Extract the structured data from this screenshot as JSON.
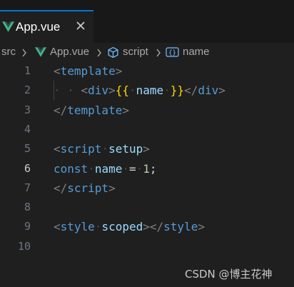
{
  "tab": {
    "title": "App.vue"
  },
  "breadcrumb": {
    "src": "src",
    "file": "App.vue",
    "section": "script",
    "symbol": "name"
  },
  "editor": {
    "active_line": "6",
    "lines": [
      {
        "number": "1",
        "tokens": [
          [
            "tg",
            "<"
          ],
          [
            "tn",
            "template"
          ],
          [
            "tg",
            ">"
          ]
        ]
      },
      {
        "number": "2",
        "tokens": [
          [
            "ws",
            "· · "
          ],
          [
            "tg",
            "<"
          ],
          [
            "tn",
            "div"
          ],
          [
            "tg",
            ">"
          ],
          [
            "br",
            "{{"
          ],
          [
            "ws",
            "·"
          ],
          [
            "vr",
            "name"
          ],
          [
            "ws",
            "·"
          ],
          [
            "br",
            "}}"
          ],
          [
            "tg",
            "</"
          ],
          [
            "tn",
            "div"
          ],
          [
            "tg",
            ">"
          ]
        ]
      },
      {
        "number": "3",
        "tokens": [
          [
            "tg",
            "</"
          ],
          [
            "tn",
            "template"
          ],
          [
            "tg",
            ">"
          ]
        ]
      },
      {
        "number": "4",
        "tokens": []
      },
      {
        "number": "5",
        "tokens": [
          [
            "tg",
            "<"
          ],
          [
            "tn",
            "script"
          ],
          [
            "ws",
            "·"
          ],
          [
            "at",
            "setup"
          ],
          [
            "tg",
            ">"
          ]
        ]
      },
      {
        "number": "6",
        "tokens": [
          [
            "kw",
            "const"
          ],
          [
            "ws",
            "·"
          ],
          [
            "vr",
            "name"
          ],
          [
            "ws",
            "·"
          ],
          [
            "op",
            "="
          ],
          [
            "ws",
            "·"
          ],
          [
            "nm",
            "1"
          ],
          [
            "op",
            ";"
          ]
        ]
      },
      {
        "number": "7",
        "tokens": [
          [
            "tg",
            "</"
          ],
          [
            "tn",
            "script"
          ],
          [
            "tg",
            ">"
          ]
        ]
      },
      {
        "number": "8",
        "tokens": []
      },
      {
        "number": "9",
        "tokens": [
          [
            "tg",
            "<"
          ],
          [
            "tn",
            "style"
          ],
          [
            "ws",
            "·"
          ],
          [
            "at",
            "scoped"
          ],
          [
            "tg",
            "></"
          ],
          [
            "tn",
            "style"
          ],
          [
            "tg",
            ">"
          ]
        ]
      },
      {
        "number": "10",
        "tokens": []
      }
    ]
  },
  "watermark": "CSDN @博主花神",
  "colors": {
    "accent": "#0078d4",
    "vue_green": "#41b883",
    "vue_dark": "#35495e",
    "cube_icon": "#75beff",
    "braces_icon": "#75beff"
  },
  "icons": [
    "vue-icon",
    "close-icon",
    "chevron-right-icon",
    "cube-icon",
    "braces-icon"
  ]
}
